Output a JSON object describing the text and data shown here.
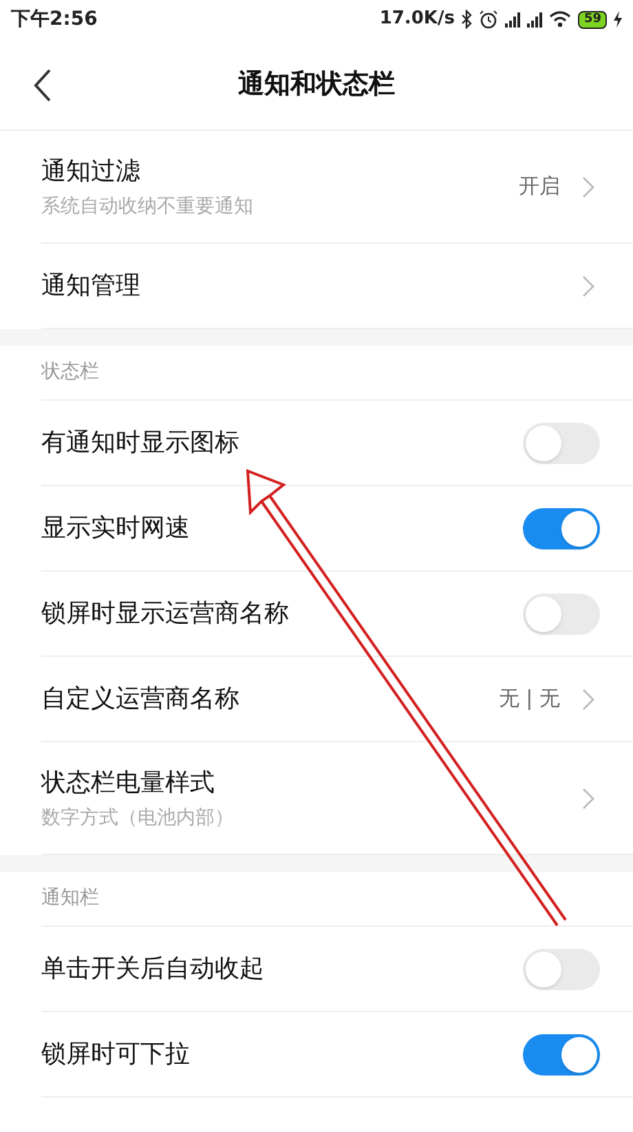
{
  "status_bar": {
    "time": "下午2:56",
    "net_speed": "17.0K/s",
    "battery": "59"
  },
  "header": {
    "title": "通知和状态栏"
  },
  "sections": [
    {
      "items": [
        {
          "kind": "link",
          "label": "通知过滤",
          "subtitle": "系统自动收纳不重要通知",
          "value": "开启"
        },
        {
          "kind": "link",
          "label": "通知管理"
        }
      ]
    },
    {
      "title": "状态栏",
      "items": [
        {
          "kind": "toggle",
          "label": "有通知时显示图标",
          "on": false
        },
        {
          "kind": "toggle",
          "label": "显示实时网速",
          "on": true
        },
        {
          "kind": "toggle",
          "label": "锁屏时显示运营商名称",
          "on": false
        },
        {
          "kind": "link",
          "label": "自定义运营商名称",
          "value": "无 | 无"
        },
        {
          "kind": "link",
          "label": "状态栏电量样式",
          "subtitle": "数字方式（电池内部）"
        }
      ]
    },
    {
      "title": "通知栏",
      "items": [
        {
          "kind": "toggle",
          "label": "单击开关后自动收起",
          "on": false
        },
        {
          "kind": "toggle",
          "label": "锁屏时可下拉",
          "on": true
        }
      ]
    }
  ]
}
